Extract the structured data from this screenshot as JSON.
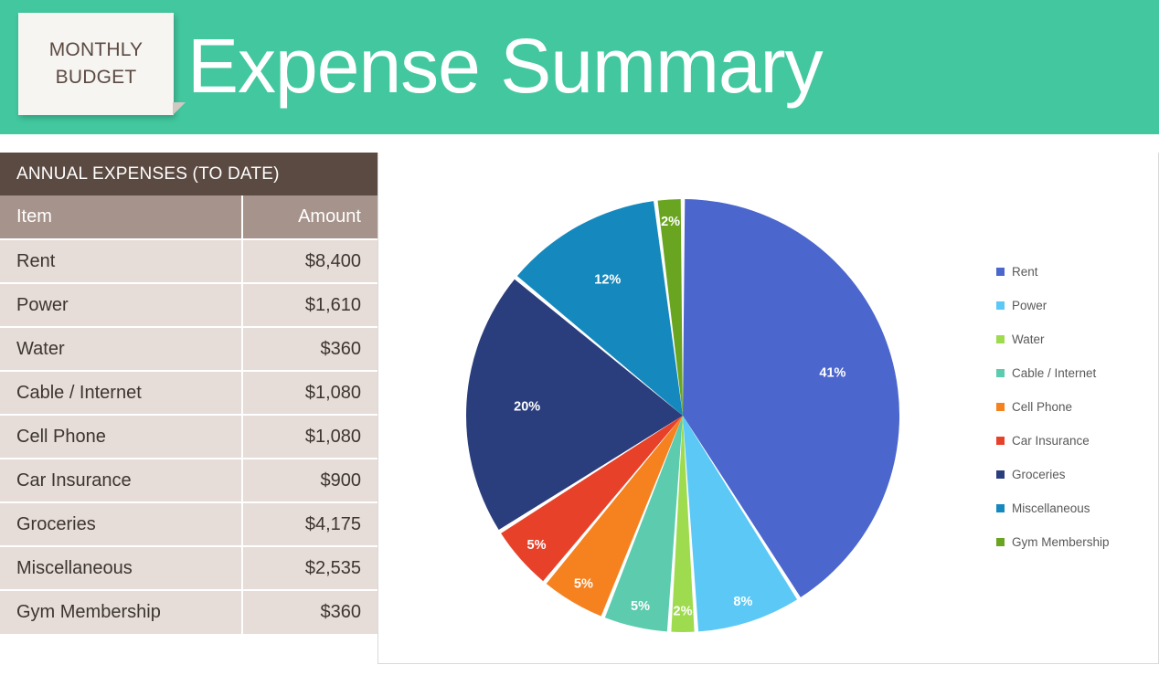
{
  "banner": {
    "badge_line1": "MONTHLY",
    "badge_line2": "BUDGET",
    "title": "Expense Summary",
    "background_color": "#42c79f",
    "title_color": "#ffffff",
    "badge_text_color": "#5b4a42"
  },
  "table": {
    "title": "ANNUAL EXPENSES (TO DATE)",
    "title_bg": "#5b4a42",
    "header_bg": "#a6938b",
    "row_bg": "#e6dcd8",
    "columns": [
      "Item",
      "Amount"
    ],
    "rows": [
      {
        "item": "Rent",
        "amount": "$8,400"
      },
      {
        "item": "Power",
        "amount": "$1,610"
      },
      {
        "item": "Water",
        "amount": "$360"
      },
      {
        "item": "Cable / Internet",
        "amount": "$1,080"
      },
      {
        "item": "Cell Phone",
        "amount": "$1,080"
      },
      {
        "item": "Car Insurance",
        "amount": "$900"
      },
      {
        "item": "Groceries",
        "amount": "$4,175"
      },
      {
        "item": "Miscellaneous",
        "amount": "$2,535"
      },
      {
        "item": "Gym Membership",
        "amount": "$360"
      }
    ]
  },
  "chart_data": {
    "type": "pie",
    "title": "",
    "legend_position": "right",
    "categories": [
      "Rent",
      "Power",
      "Water",
      "Cable / Internet",
      "Cell Phone",
      "Car Insurance",
      "Groceries",
      "Miscellaneous",
      "Gym Membership"
    ],
    "values": [
      8400,
      1610,
      360,
      1080,
      1080,
      900,
      4175,
      2535,
      360
    ],
    "percent_labels": [
      "41%",
      "8%",
      "2%",
      "5%",
      "5%",
      "5%",
      "20%",
      "12%",
      "2%"
    ],
    "percents": [
      41,
      8,
      2,
      5,
      5,
      5,
      20,
      12,
      2
    ],
    "colors": [
      "#4b66cc",
      "#5bc8f5",
      "#9edb4f",
      "#5ccbae",
      "#f5821f",
      "#e8412a",
      "#2a3d7c",
      "#1589bd",
      "#6aa521"
    ],
    "label_color": "#ffffff",
    "slice_gap_color": "#ffffff"
  },
  "legend": {
    "items": [
      {
        "label": "Rent",
        "color": "#4b66cc"
      },
      {
        "label": "Power",
        "color": "#5bc8f5"
      },
      {
        "label": "Water",
        "color": "#9edb4f"
      },
      {
        "label": "Cable / Internet",
        "color": "#5ccbae"
      },
      {
        "label": "Cell Phone",
        "color": "#f5821f"
      },
      {
        "label": "Car Insurance",
        "color": "#e8412a"
      },
      {
        "label": "Groceries",
        "color": "#2a3d7c"
      },
      {
        "label": "Miscellaneous",
        "color": "#1589bd"
      },
      {
        "label": "Gym Membership",
        "color": "#6aa521"
      }
    ]
  }
}
